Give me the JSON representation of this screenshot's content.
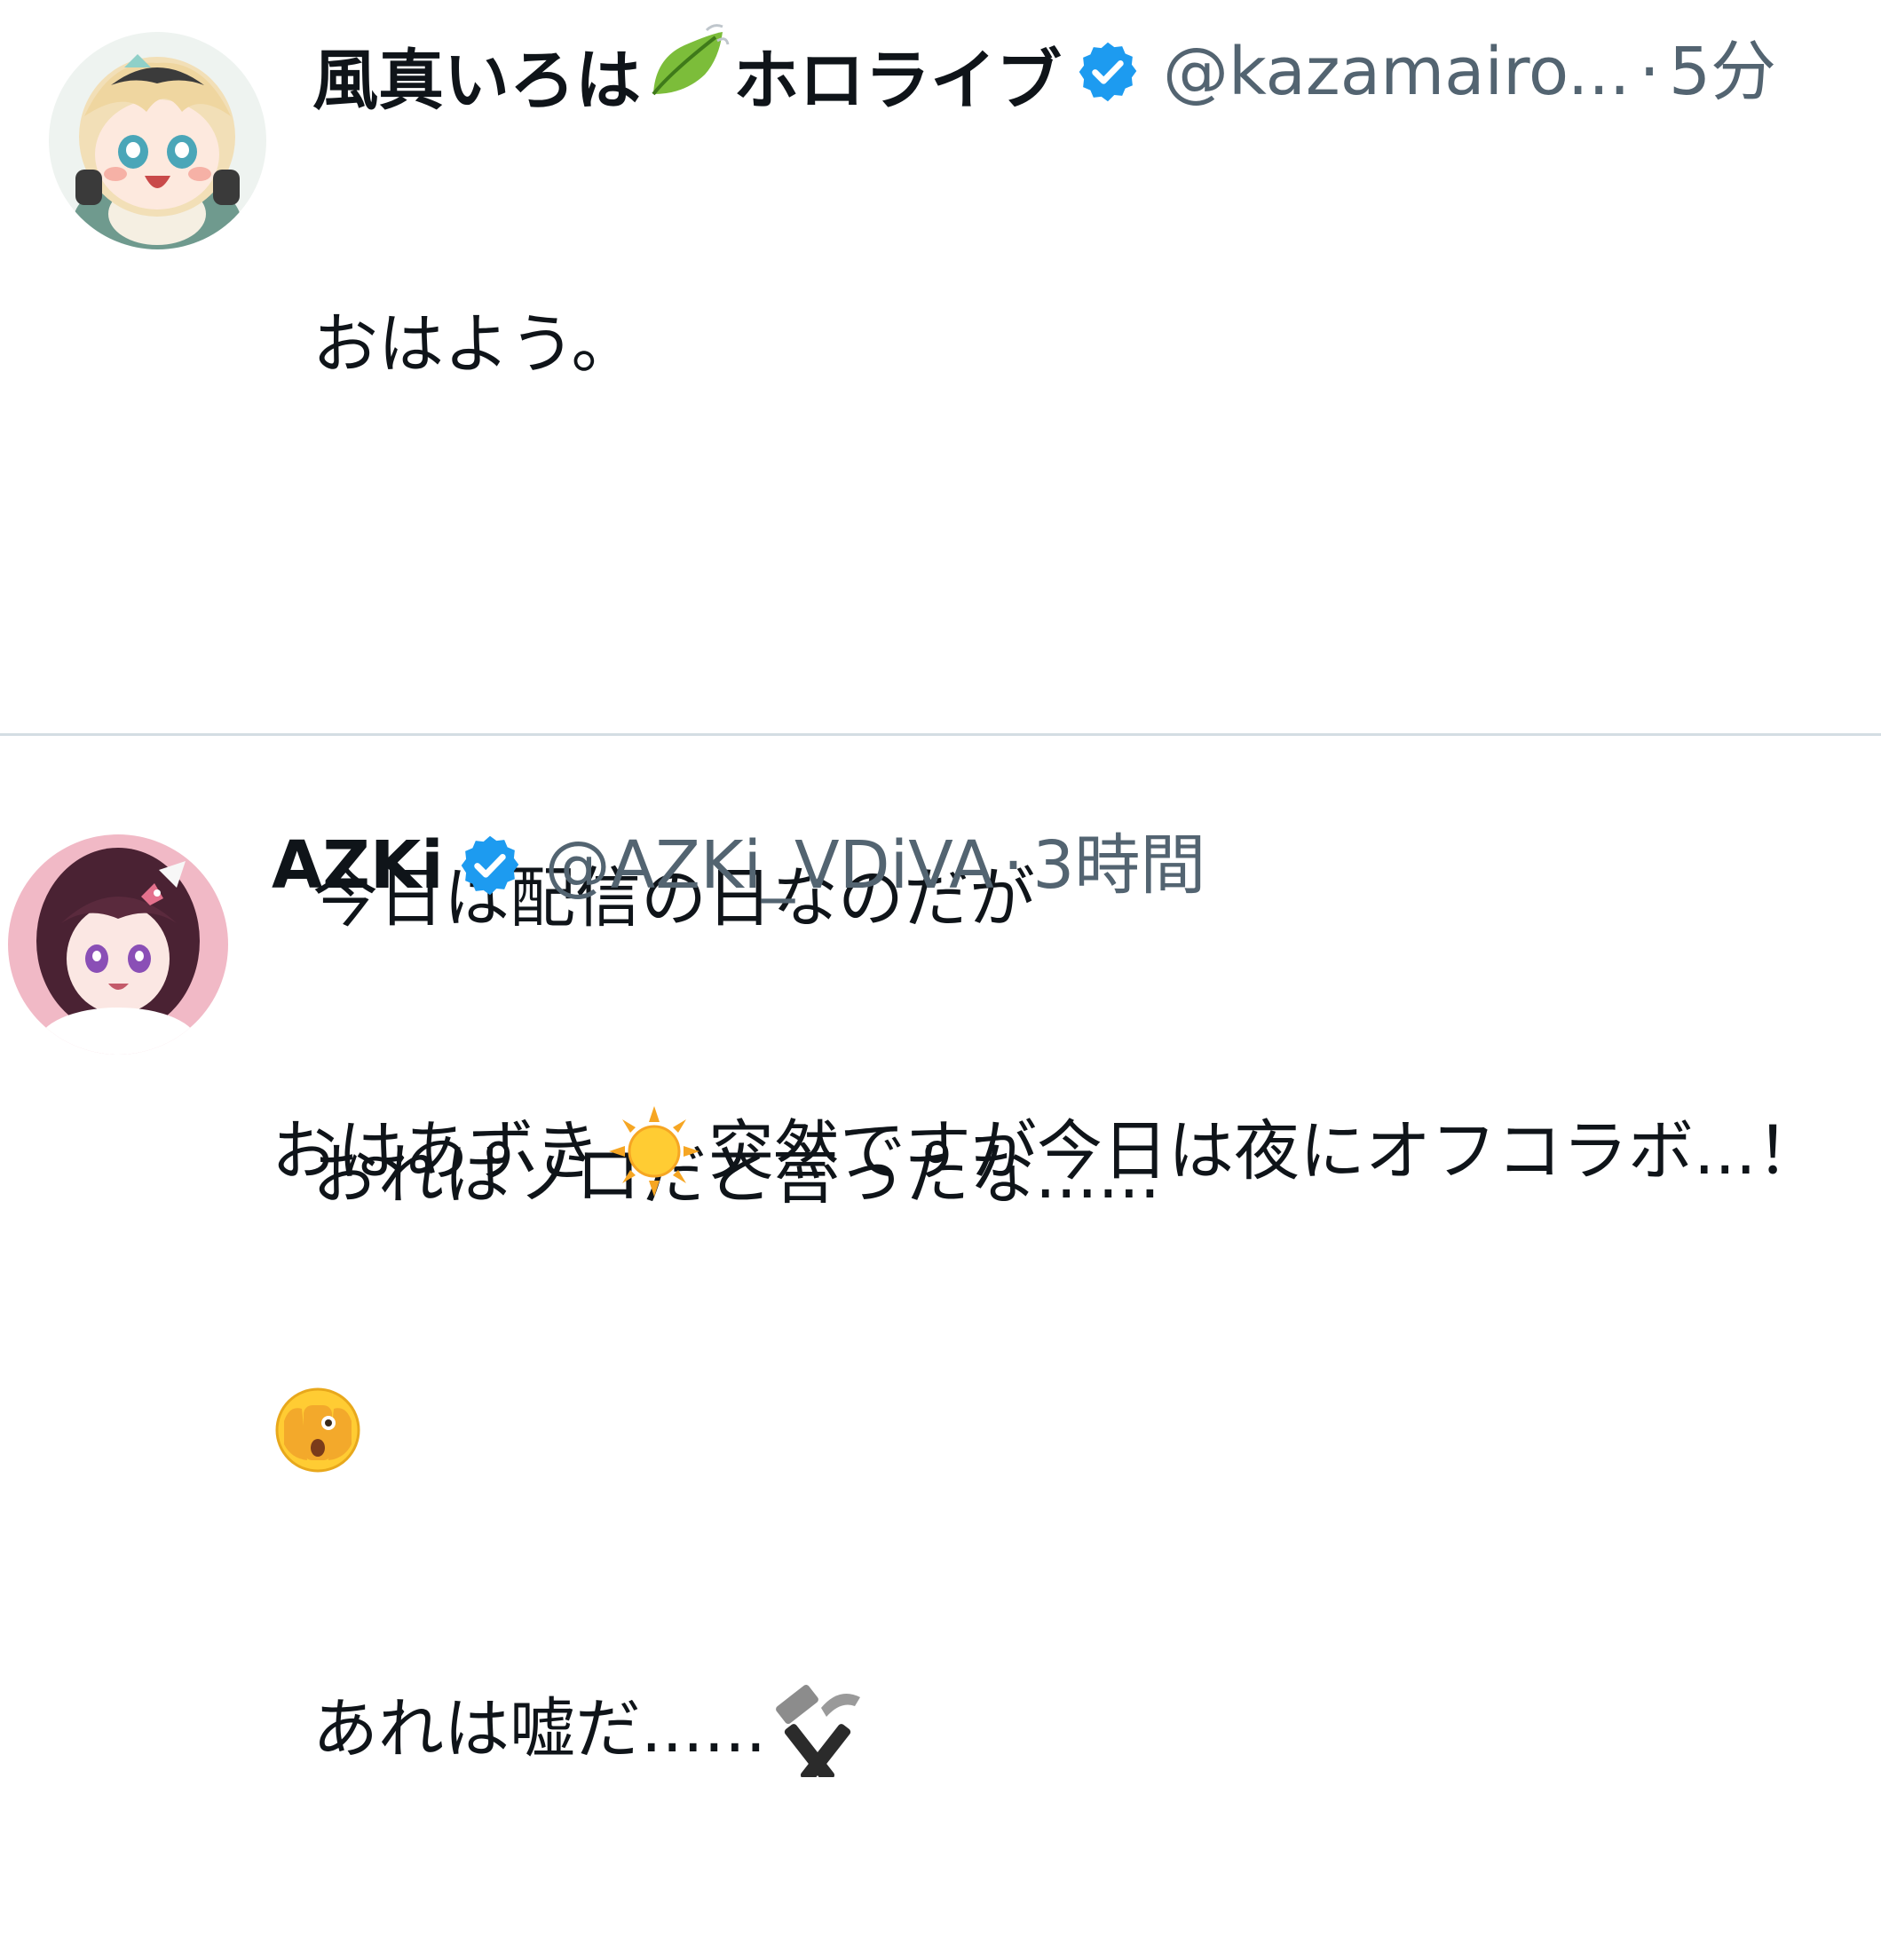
{
  "tweets": [
    {
      "display_name_part1": "風真いろは",
      "display_name_part2": "ホロライブ",
      "name_emoji": "herb-leaf-icon",
      "verified": true,
      "handle": "@kazamairo...",
      "separator": "·",
      "time": "5分",
      "body_lines": [
        "おはよう。",
        "",
        "今日は配信の日なのだが",
        "おれはソロだと言ったな......",
        "",
        "あれは嘘だ......"
      ],
      "trailing_emoji": "hammer-and-pick-icon"
    },
    {
      "display_name": "AZKi",
      "verified": true,
      "handle": "@AZKi_VDiVA",
      "separator": "·",
      "time": "3時間",
      "body_line_1_prefix": "おはあずき",
      "inline_emoji": "sun-icon",
      "body_line_1_suffix": "突然ですが今日は夜にオフコラボ...！",
      "body_line_2_emoji": "face-with-peeking-eye-icon"
    }
  ],
  "colors": {
    "text": "#0f1419",
    "secondary_text": "#536471",
    "verified_blue": "#1d9bf0",
    "divider": "#d4dde3"
  }
}
